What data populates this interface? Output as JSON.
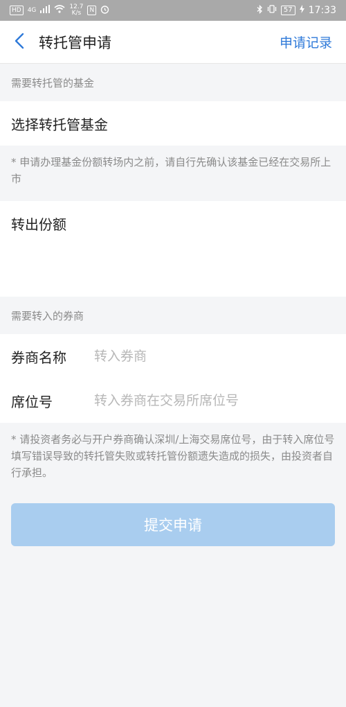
{
  "status_bar": {
    "left_badge": "HD",
    "network": "4G",
    "speed_value": "12.7",
    "speed_unit": "K/s",
    "nfc": "N",
    "battery": "57",
    "time": "17:33"
  },
  "nav": {
    "title": "转托管申请",
    "right_link": "申请记录"
  },
  "fund_section": {
    "header": "需要转托管的基金",
    "select_label": "选择转托管基金",
    "note": "* 申请办理基金份额转场内之前，请自行先确认该基金已经在交易所上市"
  },
  "amount_section": {
    "label": "转出份额"
  },
  "broker_section": {
    "header": "需要转入的券商",
    "name_label": "券商名称",
    "name_placeholder": "转入券商",
    "seat_label": "席位号",
    "seat_placeholder": "转入券商在交易所席位号",
    "note": "* 请投资者务必与开户券商确认深圳/上海交易席位号，由于转入席位号填写错误导致的转托管失败或转托管份额遗失造成的损失，由投资者自行承担。"
  },
  "submit": {
    "label": "提交申请"
  },
  "colors": {
    "accent": "#2f7ad9",
    "submit_disabled": "#a9cdef",
    "background": "#f4f5f7",
    "status_bar": "#a9a9a9"
  }
}
